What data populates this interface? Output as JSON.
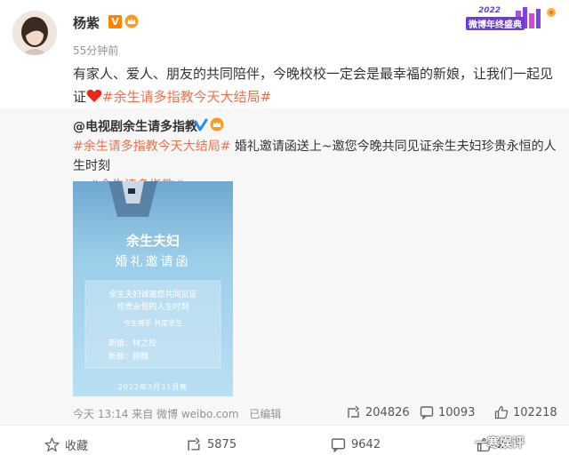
{
  "post": {
    "username": "杨紫",
    "time_ago": "55分钟前",
    "banner_text": "微博年终盛典",
    "banner_year": "2022",
    "text": "有家人、爱人、朋友的共同陪伴，今晚校校一定会是最幸福的新娘，让我们一起见证",
    "hashtag": "#余生请多指教今天大结局#"
  },
  "repost": {
    "author": "@电视剧余生请多指教",
    "hashtag1": "#余生请多指教今天大结局#",
    "text": "婚礼邀请函送上~邀您今晚共同见证余生夫妇珍贵永恒的人生时刻",
    "xi_char": "囍",
    "hashtag2": "#余生请多指教#",
    "card": {
      "title": "余生夫妇",
      "subtitle": "婚礼邀请函",
      "line1": "余生夫妇诚邀您共同见证",
      "line2": "珍贵永恒的人生时刻",
      "line3": "今生携手 共度余生",
      "groom": "新娘：林之校",
      "bride": "新郎：顾魏",
      "date": "2022年3月31日晚"
    },
    "footer": {
      "time": "今天 13:14 来自 微博 weibo.com",
      "edited": "已编辑",
      "reposts": "204826",
      "comments": "10093",
      "likes": "102218"
    }
  },
  "footer": {
    "favorite": "收藏",
    "reposts": "5875",
    "comments": "9642",
    "likes": "2"
  },
  "watermark": "一寒娱评",
  "colors": {
    "accent": "#eb7350",
    "verified_orange": "#ff8200",
    "verified_blue": "#1f8ef1",
    "card_blue": "#8fc7e8"
  }
}
